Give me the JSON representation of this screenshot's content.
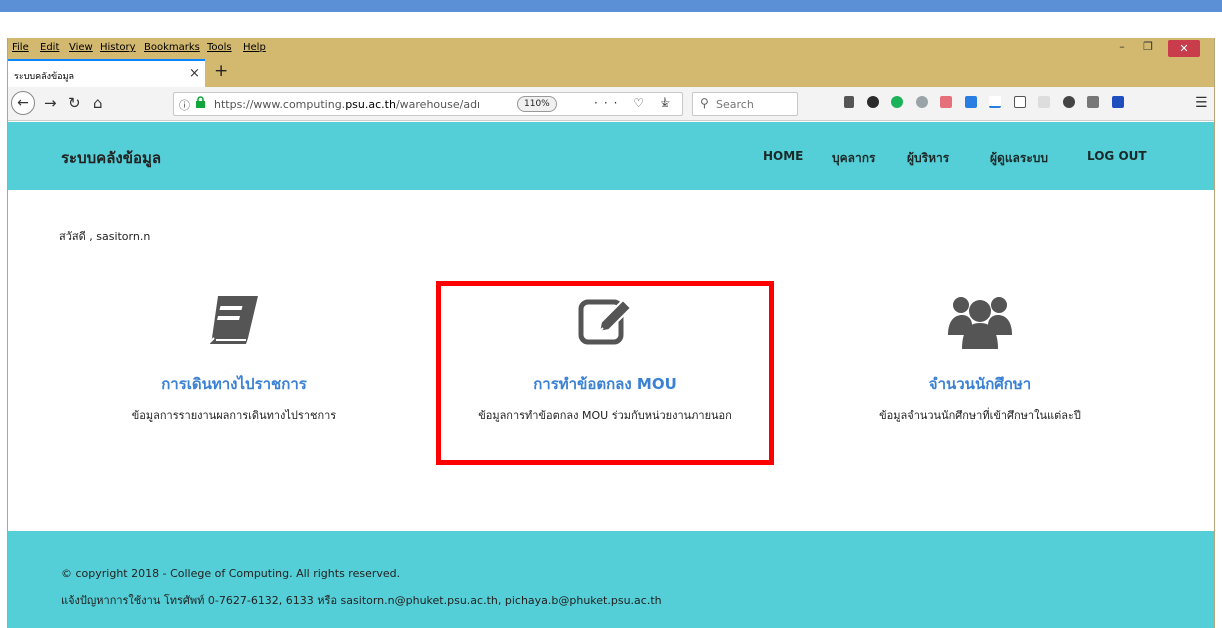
{
  "browser": {
    "menu": [
      "File",
      "Edit",
      "View",
      "History",
      "Bookmarks",
      "Tools",
      "Help"
    ],
    "window_controls": {
      "minimize": "–",
      "restore": "❐",
      "close": "✕"
    },
    "tab": {
      "title": "ระบบคลังข้อมูล",
      "close": "×",
      "new_tab": "+"
    },
    "url": {
      "prefix": "https://www.computing.",
      "domain": "psu.ac.th",
      "suffix": "/warehouse/adm"
    },
    "zoom": "110%",
    "search_placeholder": "Search",
    "colors": {
      "accent": "#0a84ff",
      "titlebar": "#d3b870"
    }
  },
  "site": {
    "brand": "ระบบคลังข้อมูล",
    "nav": [
      "HOME",
      "บุคลากร",
      "ผู้บริหาร",
      "ผู้ดูแลระบบ",
      "LOG OUT"
    ],
    "greeting": "สวัสดี ,  sasitorn.n",
    "cards": [
      {
        "icon": "book-icon",
        "title": "การเดินทางไปราชการ",
        "desc": "ข้อมูลการรายงานผลการเดินทางไปราชการ"
      },
      {
        "icon": "edit-icon",
        "title": "การทำข้อตกลง MOU",
        "desc": "ข้อมูลการทำข้อตกลง MOU ร่วมกับหน่วยงานภายนอก"
      },
      {
        "icon": "users-icon",
        "title": "จำนวนนักศึกษา",
        "desc": "ข้อมูลจำนวนนักศึกษาที่เข้าศึกษาในแต่ละปี"
      }
    ],
    "footer": {
      "copyright": "© copyright 2018 - College of Computing. All rights reserved.",
      "contact": "แจ้งปัญหาการใช้งาน โทรศัพท์ 0-7627-6132, 6133 หรือ sasitorn.n@phuket.psu.ac.th, pichaya.b@phuket.psu.ac.th"
    },
    "colors": {
      "header": "#55cfd7",
      "link": "#3b82d4",
      "highlight": "#ff0000"
    }
  }
}
